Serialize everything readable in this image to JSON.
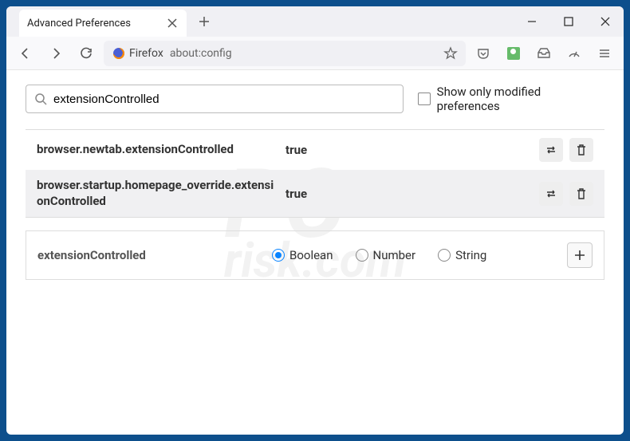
{
  "tab": {
    "title": "Advanced Preferences"
  },
  "urlbar": {
    "brand": "Firefox",
    "url": "about:config"
  },
  "search": {
    "value": "extensionControlled",
    "modified_only_label": "Show only modified preferences",
    "modified_only_checked": false
  },
  "prefs": [
    {
      "name": "browser.newtab.extensionControlled",
      "value": "true"
    },
    {
      "name": "browser.startup.homepage_override.extensionControlled",
      "value": "true"
    }
  ],
  "newpref": {
    "name": "extensionControlled",
    "types": [
      "Boolean",
      "Number",
      "String"
    ],
    "selected": "Boolean"
  }
}
